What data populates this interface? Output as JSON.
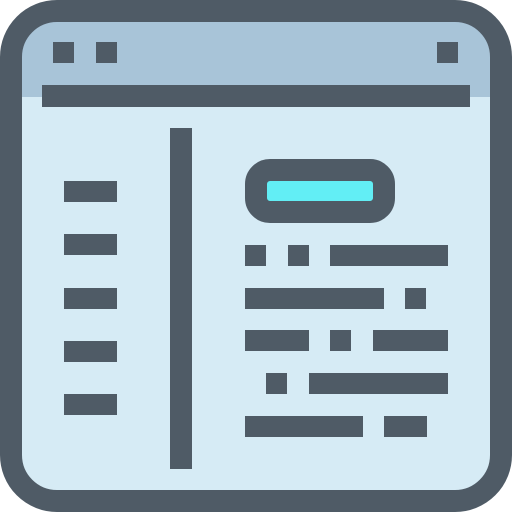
{
  "icon": {
    "name": "browser-window-document-icon",
    "colors": {
      "outline": "#4f5b66",
      "titlebar": "#a8c4d8",
      "content": "#d6ebf5",
      "accent": "#62eef5"
    },
    "parts": [
      "window-frame",
      "title-bar",
      "sidebar",
      "content-lines",
      "header-button"
    ]
  }
}
